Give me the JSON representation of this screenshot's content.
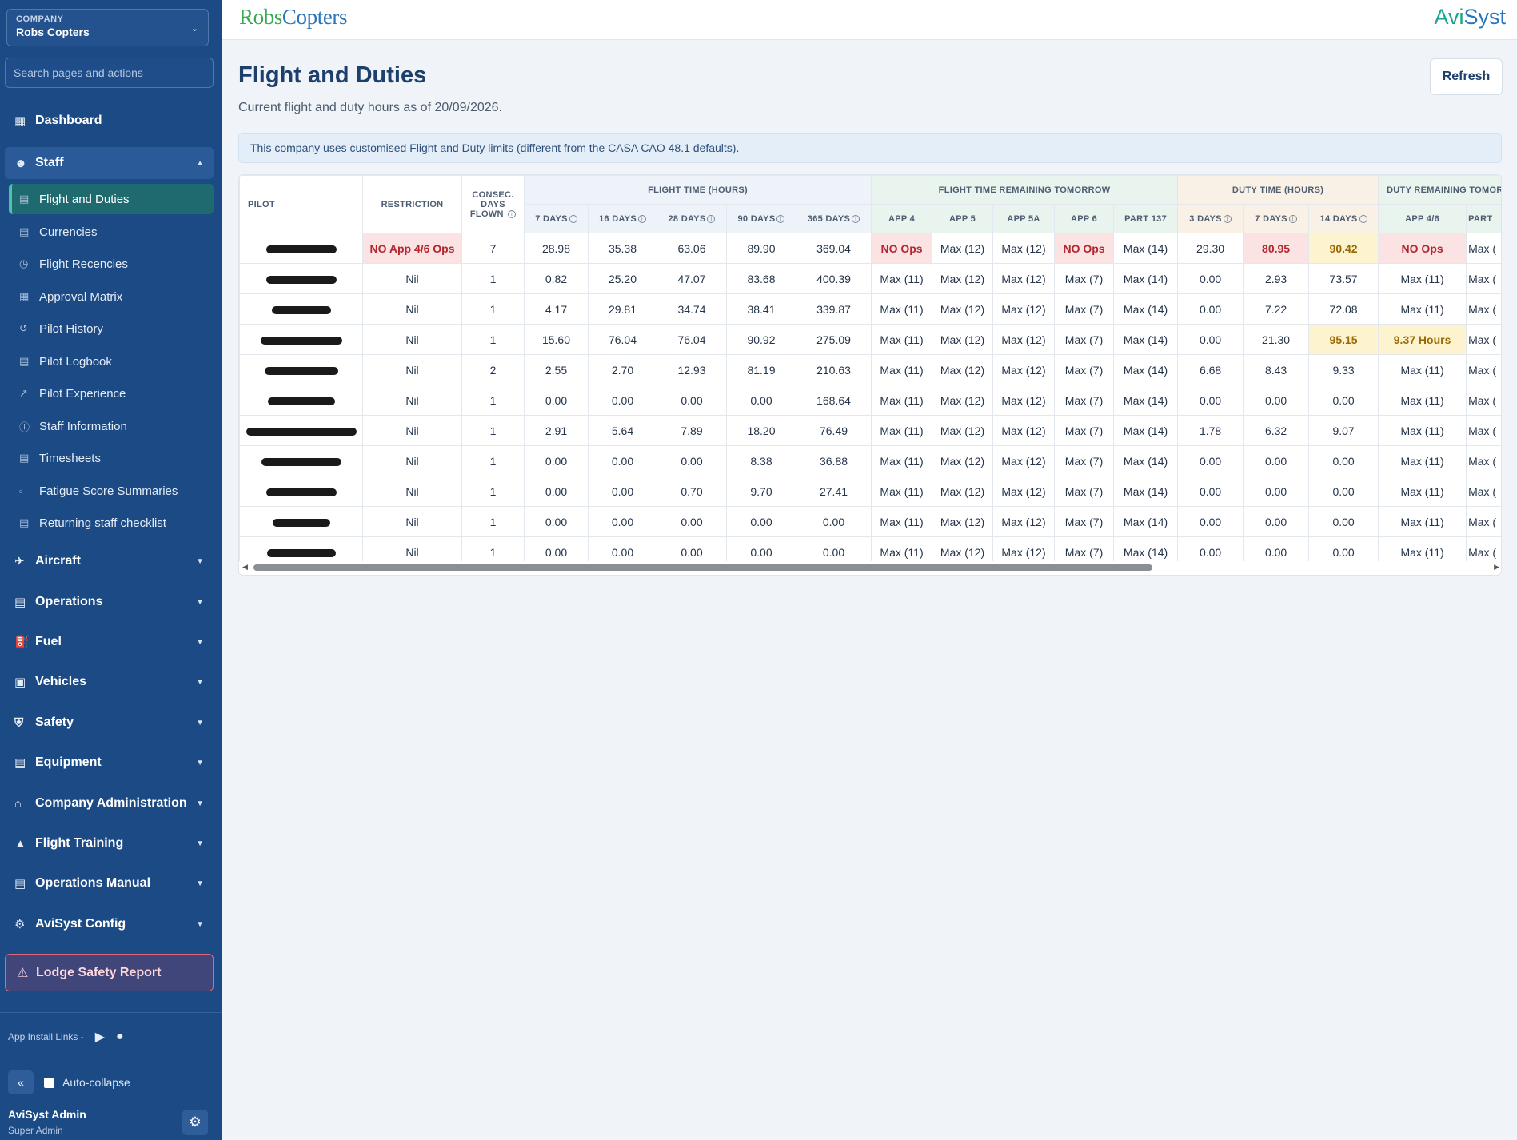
{
  "company": {
    "label": "COMPANY",
    "name": "Robs Copters"
  },
  "search": {
    "placeholder": "Search pages and actions"
  },
  "nav": {
    "dashboard": "Dashboard",
    "staff": "Staff",
    "staff_items": [
      "Flight and Duties",
      "Currencies",
      "Flight Recencies",
      "Approval Matrix",
      "Pilot History",
      "Pilot Logbook",
      "Pilot Experience",
      "Staff Information",
      "Timesheets",
      "Fatigue Score Summaries",
      "Returning staff checklist"
    ],
    "sections": [
      "Aircraft",
      "Operations",
      "Fuel",
      "Vehicles",
      "Safety",
      "Equipment",
      "Company Administration",
      "Flight Training",
      "Operations Manual",
      "AviSyst Config"
    ]
  },
  "lodge": "Lodge Safety Report",
  "app_links": "App Install Links -",
  "collapse": {
    "button": "«",
    "label": "Auto-collapse"
  },
  "user": {
    "name": "AviSyst Admin",
    "role": "Super Admin"
  },
  "brand": {
    "left_a": "Robs",
    "left_b": "Copters",
    "right_a": "Avi",
    "right_b": "Syst"
  },
  "page": {
    "title": "Flight and Duties",
    "subtitle": "Current flight and duty hours as of 20/09/2026.",
    "refresh": "Refresh",
    "info": "This company uses customised Flight and Duty limits (different from the CASA CAO 48.1 defaults)."
  },
  "table": {
    "group_headers": {
      "pilot": "PILOT",
      "restriction": "RESTRICTION",
      "consec": "CONSEC. DAYS FLOWN",
      "flight_time": "FLIGHT TIME (HOURS)",
      "flight_remaining": "FLIGHT TIME REMAINING TOMORROW",
      "duty_time": "DUTY TIME (HOURS)",
      "duty_remaining": "DUTY REMAINING TOMOR"
    },
    "sub_headers": [
      "7 DAYS",
      "16 DAYS",
      "28 DAYS",
      "90 DAYS",
      "365 DAYS",
      "APP 4",
      "APP 5",
      "APP 5A",
      "APP 6",
      "PART 137",
      "3 DAYS",
      "7 DAYS",
      "14 DAYS",
      "APP 4/6",
      "PART"
    ],
    "rows": [
      [
        "NO App 4/6 Ops",
        "7",
        "28.98",
        "35.38",
        "63.06",
        "89.90",
        "369.04",
        "NO Ops",
        "Max (12)",
        "Max (12)",
        "NO Ops",
        "Max (14)",
        "29.30",
        "80.95",
        "90.42",
        "NO Ops",
        "Max ("
      ],
      [
        "Nil",
        "1",
        "0.82",
        "25.20",
        "47.07",
        "83.68",
        "400.39",
        "Max (11)",
        "Max (12)",
        "Max (12)",
        "Max (7)",
        "Max (14)",
        "0.00",
        "2.93",
        "73.57",
        "Max (11)",
        "Max ("
      ],
      [
        "Nil",
        "1",
        "4.17",
        "29.81",
        "34.74",
        "38.41",
        "339.87",
        "Max (11)",
        "Max (12)",
        "Max (12)",
        "Max (7)",
        "Max (14)",
        "0.00",
        "7.22",
        "72.08",
        "Max (11)",
        "Max ("
      ],
      [
        "Nil",
        "1",
        "15.60",
        "76.04",
        "76.04",
        "90.92",
        "275.09",
        "Max (11)",
        "Max (12)",
        "Max (12)",
        "Max (7)",
        "Max (14)",
        "0.00",
        "21.30",
        "95.15",
        "9.37 Hours",
        "Max ("
      ],
      [
        "Nil",
        "2",
        "2.55",
        "2.70",
        "12.93",
        "81.19",
        "210.63",
        "Max (11)",
        "Max (12)",
        "Max (12)",
        "Max (7)",
        "Max (14)",
        "6.68",
        "8.43",
        "9.33",
        "Max (11)",
        "Max ("
      ],
      [
        "Nil",
        "1",
        "0.00",
        "0.00",
        "0.00",
        "0.00",
        "168.64",
        "Max (11)",
        "Max (12)",
        "Max (12)",
        "Max (7)",
        "Max (14)",
        "0.00",
        "0.00",
        "0.00",
        "Max (11)",
        "Max ("
      ],
      [
        "Nil",
        "1",
        "2.91",
        "5.64",
        "7.89",
        "18.20",
        "76.49",
        "Max (11)",
        "Max (12)",
        "Max (12)",
        "Max (7)",
        "Max (14)",
        "1.78",
        "6.32",
        "9.07",
        "Max (11)",
        "Max ("
      ],
      [
        "Nil",
        "1",
        "0.00",
        "0.00",
        "0.00",
        "8.38",
        "36.88",
        "Max (11)",
        "Max (12)",
        "Max (12)",
        "Max (7)",
        "Max (14)",
        "0.00",
        "0.00",
        "0.00",
        "Max (11)",
        "Max ("
      ],
      [
        "Nil",
        "1",
        "0.00",
        "0.00",
        "0.70",
        "9.70",
        "27.41",
        "Max (11)",
        "Max (12)",
        "Max (12)",
        "Max (7)",
        "Max (14)",
        "0.00",
        "0.00",
        "0.00",
        "Max (11)",
        "Max ("
      ],
      [
        "Nil",
        "1",
        "0.00",
        "0.00",
        "0.00",
        "0.00",
        "0.00",
        "Max (11)",
        "Max (12)",
        "Max (12)",
        "Max (7)",
        "Max (14)",
        "0.00",
        "0.00",
        "0.00",
        "Max (11)",
        "Max ("
      ],
      [
        "Nil",
        "1",
        "0.00",
        "0.00",
        "0.00",
        "0.00",
        "0.00",
        "Max (11)",
        "Max (12)",
        "Max (12)",
        "Max (7)",
        "Max (14)",
        "0.00",
        "0.00",
        "0.00",
        "Max (11)",
        "Max ("
      ]
    ],
    "highlights": {
      "red": [
        "0-0",
        "0-7",
        "0-10",
        "0-13",
        "0-15"
      ],
      "yellow": [
        "0-14",
        "3-14",
        "3-15"
      ]
    },
    "redacted_pilot_count": 11
  },
  "colors": {
    "sidebar": "#1c4a85",
    "accent_teal": "#1f6a6e",
    "danger": "#b3262e",
    "warning": "#9a6a00"
  }
}
